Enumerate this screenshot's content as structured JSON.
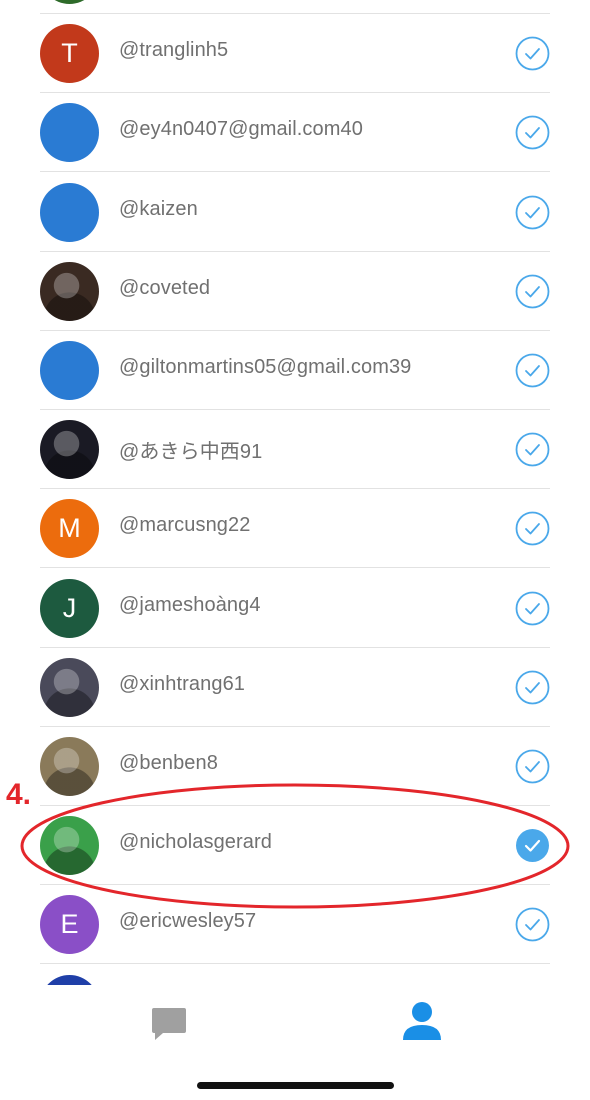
{
  "contacts": [
    {
      "handle": "",
      "avatar": {
        "kind": "color",
        "color": "#2e6b2a",
        "letter": ""
      },
      "selected": false
    },
    {
      "handle": "@tranglinh5",
      "avatar": {
        "kind": "letter",
        "color": "#c2391b",
        "letter": "T"
      },
      "selected": false
    },
    {
      "handle": "@ey4n0407@gmail.com40",
      "avatar": {
        "kind": "color",
        "color": "#2a7bd3",
        "letter": ""
      },
      "selected": false
    },
    {
      "handle": "@kaizen",
      "avatar": {
        "kind": "color",
        "color": "#2a7bd3",
        "letter": ""
      },
      "selected": false
    },
    {
      "handle": "@coveted",
      "avatar": {
        "kind": "photo",
        "color": "#3a2a22",
        "letter": ""
      },
      "selected": false
    },
    {
      "handle": "@giltonmartins05@gmail.com39",
      "avatar": {
        "kind": "color",
        "color": "#2a7bd3",
        "letter": ""
      },
      "selected": false
    },
    {
      "handle": "@あきら中西91",
      "avatar": {
        "kind": "photo",
        "color": "#1a1a24",
        "letter": ""
      },
      "selected": false
    },
    {
      "handle": "@marcusng22",
      "avatar": {
        "kind": "letter",
        "color": "#ec6c0d",
        "letter": "M"
      },
      "selected": false
    },
    {
      "handle": "@jameshoàng4",
      "avatar": {
        "kind": "letter",
        "color": "#1d5a3f",
        "letter": "J"
      },
      "selected": false
    },
    {
      "handle": "@xinhtrang61",
      "avatar": {
        "kind": "photo",
        "color": "#4a4a5a",
        "letter": ""
      },
      "selected": false
    },
    {
      "handle": "@benben8",
      "avatar": {
        "kind": "photo",
        "color": "#8a7a5a",
        "letter": ""
      },
      "selected": false
    },
    {
      "handle": "@nicholasgerard",
      "avatar": {
        "kind": "photo",
        "color": "#3aa04a",
        "letter": ""
      },
      "selected": true
    },
    {
      "handle": "@ericwesley57",
      "avatar": {
        "kind": "letter",
        "color": "#8a4fc7",
        "letter": "E"
      },
      "selected": false
    },
    {
      "handle": "",
      "avatar": {
        "kind": "photo",
        "color": "#1f3fa8",
        "letter": ""
      },
      "selected": false
    }
  ],
  "tabs": [
    {
      "name": "messages",
      "icon": "chat-bubble-icon",
      "color": "#a0a0a0",
      "active": false
    },
    {
      "name": "contacts",
      "icon": "person-icon",
      "color": "#1a8fe6",
      "active": true
    }
  ],
  "annotation": {
    "label": "4.",
    "color": "#e3262b"
  },
  "colors": {
    "check": "#4aa8ea",
    "divider": "#e2e2e2",
    "text": "#707070"
  }
}
